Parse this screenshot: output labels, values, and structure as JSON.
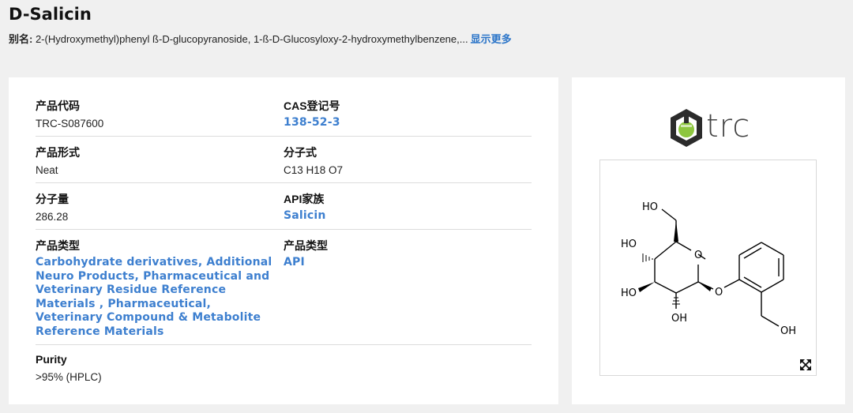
{
  "product": {
    "title": "D-Salicin",
    "alias_label": "别名:",
    "aliases": " 2-(Hydroxymethyl)phenyl ß-D-glucopyranoside, 1-ß-D-Glucosyloxy-2-hydroxymethylbenzene,...",
    "show_more": "显示更多"
  },
  "details": {
    "code_label": "产品代码",
    "code_value": "TRC-S087600",
    "cas_label": "CAS登记号",
    "cas_value": "138-52-3",
    "form_label": "产品形式",
    "form_value": "Neat",
    "formula_label": "分子式",
    "formula_value": "C13 H18 O7",
    "mw_label": "分子量",
    "mw_value": "286.28",
    "api_family_label": "API家族",
    "api_family_value": "Salicin",
    "type_label": "产品类型",
    "type_value": "Carbohydrate derivatives, Additional Neuro Products, Pharmaceutical and Veterinary Residue Reference Materials , Pharmaceutical, Veterinary Compound & Metabolite Reference Materials",
    "type2_label": "产品类型",
    "type2_value": "API",
    "purity_label": "Purity",
    "purity_value": ">95% (HPLC)"
  },
  "brand": {
    "logo_text": "trc",
    "accent": "#8dc63f",
    "dark": "#2b2b2b"
  },
  "structure": {
    "labels": {
      "ho_top": "HO",
      "ho_left1": "HO",
      "ho_left2": "HO",
      "oh_bottom": "OH",
      "oh_right": "OH",
      "ring_o": "O",
      "link_o": "O"
    },
    "expand_icon": "expand-icon"
  }
}
